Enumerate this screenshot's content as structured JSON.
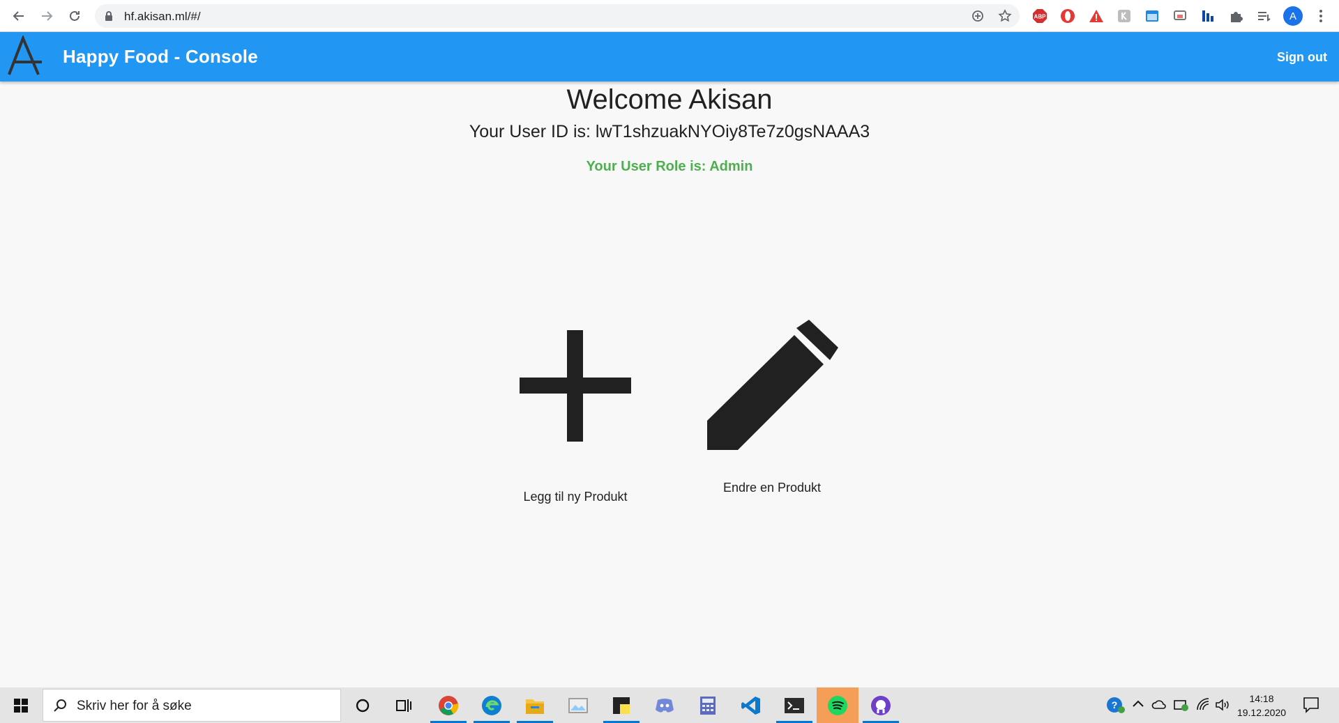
{
  "browser": {
    "url": "hf.akisan.ml/#/",
    "profile_initial": "A",
    "extensions": [
      "abp-icon",
      "opera-icon",
      "warning-icon",
      "extension-k-icon",
      "extension-window-icon",
      "extension-cast-icon",
      "extension-bars-icon",
      "puzzle-icon",
      "reading-list-icon"
    ],
    "extension_labels": {
      "abp": "ABP"
    }
  },
  "header": {
    "logo": "A",
    "title": "Happy Food - Console",
    "sign_out": "Sign out",
    "bg_color": "#2196f3"
  },
  "main": {
    "welcome": "Welcome Akisan",
    "user_id": "Your User ID is: lwT1shzuakNYOiy8Te7z0gsNAAA3",
    "user_role": "Your User Role is: Admin",
    "role_color": "#4caf50",
    "actions": [
      {
        "icon": "plus-icon",
        "label": "Legg til ny Produkt"
      },
      {
        "icon": "pencil-icon",
        "label": "Endre en Produkt"
      }
    ]
  },
  "taskbar": {
    "search_placeholder": "Skriv her for å søke",
    "apps": [
      "chrome-icon",
      "edge-icon",
      "file-explorer-icon",
      "photos-icon",
      "sticky-notes-icon",
      "discord-icon",
      "calculator-icon",
      "vscode-icon",
      "terminal-icon",
      "spotify-icon",
      "github-icon"
    ],
    "time": "14:18",
    "date": "19.12.2020"
  }
}
